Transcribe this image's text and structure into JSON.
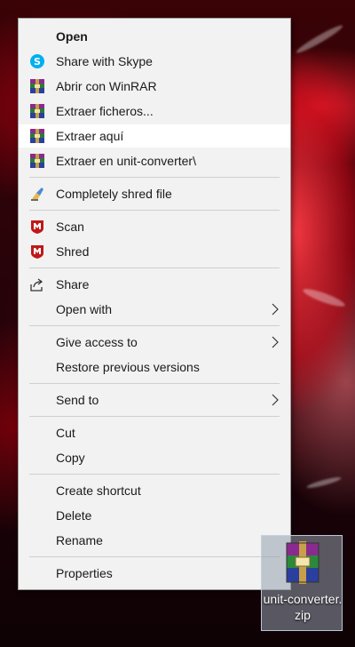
{
  "context_menu": {
    "items": [
      {
        "label": "Open",
        "icon": null,
        "bold": true
      },
      {
        "label": "Share with Skype",
        "icon": "skype-icon"
      },
      {
        "label": "Abrir con WinRAR",
        "icon": "winrar-icon"
      },
      {
        "label": "Extraer ficheros...",
        "icon": "winrar-icon"
      },
      {
        "label": "Extraer aquí",
        "icon": "winrar-icon",
        "highlighted": true
      },
      {
        "label": "Extraer en unit-converter\\",
        "icon": "winrar-icon"
      },
      {
        "label": "Completely shred file",
        "icon": "shred-broom-icon"
      },
      {
        "label": "Scan",
        "icon": "mcafee-icon"
      },
      {
        "label": "Shred",
        "icon": "mcafee-icon"
      },
      {
        "label": "Share",
        "icon": "share-icon"
      },
      {
        "label": "Open with",
        "icon": null,
        "submenu": true
      },
      {
        "label": "Give access to",
        "icon": null,
        "submenu": true
      },
      {
        "label": "Restore previous versions",
        "icon": null
      },
      {
        "label": "Send to",
        "icon": null,
        "submenu": true
      },
      {
        "label": "Cut",
        "icon": null
      },
      {
        "label": "Copy",
        "icon": null
      },
      {
        "label": "Create shortcut",
        "icon": null
      },
      {
        "label": "Delete",
        "icon": null
      },
      {
        "label": "Rename",
        "icon": null
      },
      {
        "label": "Properties",
        "icon": null
      }
    ]
  },
  "desktop_file": {
    "name": "unit-converter.zip",
    "icon": "winrar-archive-icon",
    "selected": true
  },
  "colors": {
    "menu_bg": "#f2f2f2",
    "menu_hover": "#ffffff",
    "skype": "#00aff0",
    "mcafee": "#c01818"
  }
}
